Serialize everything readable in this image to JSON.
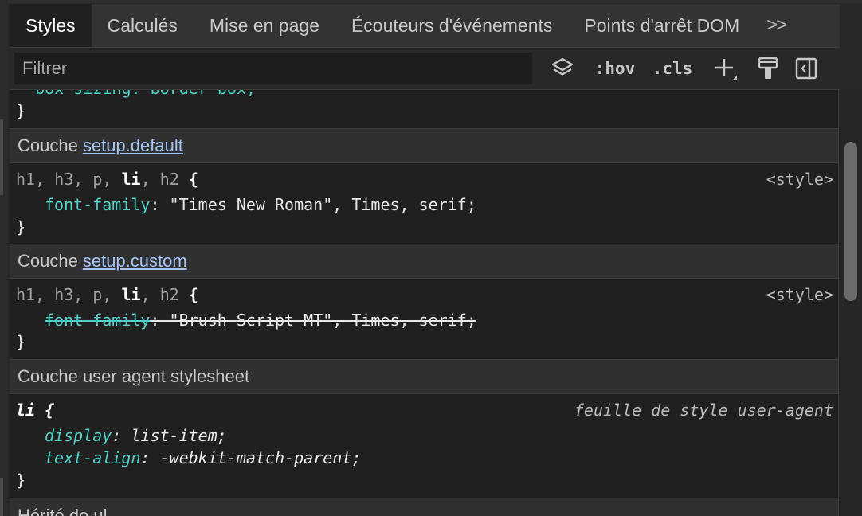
{
  "tabs": [
    {
      "label": "Styles",
      "active": true
    },
    {
      "label": "Calculés",
      "active": false
    },
    {
      "label": "Mise en page",
      "active": false
    },
    {
      "label": "Écouteurs d'événements",
      "active": false
    },
    {
      "label": "Points d'arrêt DOM",
      "active": false
    }
  ],
  "tabs_overflow": ">>",
  "toolbar": {
    "filter_placeholder": "Filtrer",
    "hov_label": ":hov",
    "cls_label": ".cls",
    "icons": [
      "layers-icon",
      "add-rule-icon",
      "paint-brush-icon",
      "sidebar-toggle-icon"
    ]
  },
  "rules": {
    "prev_partial_line": "  box-sizing: border-box;",
    "prev_close": "}",
    "layer1": {
      "prefix": "Couche",
      "link": "setup.default",
      "selector_parts": [
        "h1",
        "h3",
        "p",
        "li",
        "h2"
      ],
      "open": "{",
      "source": "<style>",
      "prop": "font-family",
      "colon": ":",
      "value": " \"Times New Roman\", Times, serif;",
      "close": "}"
    },
    "layer2": {
      "prefix": "Couche",
      "link": "setup.custom",
      "selector_parts": [
        "h1",
        "h3",
        "p",
        "li",
        "h2"
      ],
      "open": "{",
      "source": "<style>",
      "prop": "font-family",
      "colon": ":",
      "value": " \"Brush Script MT\", Times, serif;",
      "close": "}"
    },
    "layer3": {
      "title": "Couche user agent stylesheet",
      "selector": "li {",
      "source": "feuille de style user-agent",
      "decls": [
        {
          "prop": "display",
          "value": " list-item;"
        },
        {
          "prop": "text-align",
          "value": " -webkit-match-parent;"
        }
      ],
      "close": "}"
    },
    "inherited_partial": "Hérité de ul"
  },
  "colors": {
    "accent_link": "#a6c4f4",
    "property": "#4fd1c5",
    "background": "#202020"
  }
}
